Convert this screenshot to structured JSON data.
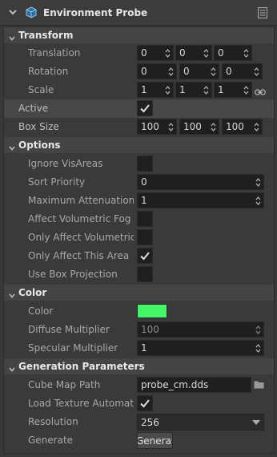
{
  "header": {
    "title": "Environment Probe"
  },
  "sections": {
    "transform": "Transform",
    "options": "Options",
    "color": "Color",
    "generation": "Generation Parameters"
  },
  "transform": {
    "translation": {
      "label": "Translation",
      "x": "0",
      "y": "0",
      "z": "0"
    },
    "rotation": {
      "label": "Rotation",
      "x": "0",
      "y": "0",
      "z": "0"
    },
    "scale": {
      "label": "Scale",
      "x": "1",
      "y": "1",
      "z": "1"
    }
  },
  "active": {
    "label": "Active",
    "checked": true
  },
  "box_size": {
    "label": "Box Size",
    "x": "100",
    "y": "100",
    "z": "100"
  },
  "options": {
    "ignore_visareas": {
      "label": "Ignore VisAreas",
      "checked": false
    },
    "sort_priority": {
      "label": "Sort Priority",
      "value": "0"
    },
    "max_attenuation": {
      "label": "Maximum Attenuation F",
      "value": "1"
    },
    "affect_volumetric_fog": {
      "label": "Affect Volumetric Fog",
      "checked": false
    },
    "only_affect_volumetric": {
      "label": "Only Affect Volumetric F",
      "checked": false
    },
    "only_affect_this_area": {
      "label": "Only Affect This Area",
      "checked": true
    },
    "use_box_projection": {
      "label": "Use Box Projection",
      "checked": false
    }
  },
  "color": {
    "color": {
      "label": "Color",
      "swatch": "#44f568"
    },
    "diffuse_multiplier": {
      "label": "Diffuse Multiplier",
      "value": "100"
    },
    "specular_multiplier": {
      "label": "Specular Multiplier",
      "value": "1"
    }
  },
  "generation": {
    "cube_map_path": {
      "label": "Cube Map Path",
      "value": "probe_cm.dds"
    },
    "load_texture_automatic": {
      "label": "Load Texture Automatic",
      "checked": true
    },
    "resolution": {
      "label": "Resolution",
      "value": "256"
    },
    "generate": {
      "label": "Generate",
      "button": "Generate"
    }
  },
  "icons": {
    "header_chevron": "chevron-down-icon",
    "header_cube": "cube-icon",
    "header_menu": "menu-icon",
    "link": "link-icon",
    "folder": "folder-icon",
    "dropdown": "dropdown-arrow-icon"
  }
}
